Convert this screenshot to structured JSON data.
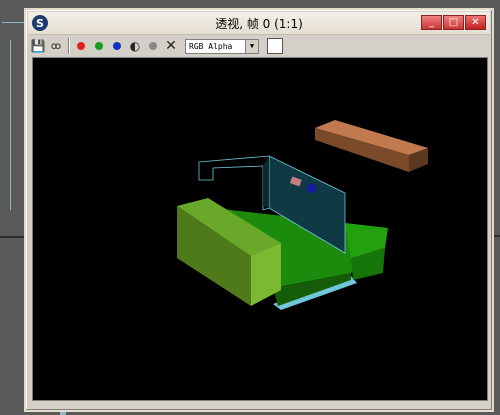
{
  "window": {
    "title": "透视, 帧 0 (1:1)",
    "icon": "3dsmax-logo-icon"
  },
  "title_buttons": [
    "minimize-icon",
    "maximize-icon",
    "close-icon"
  ],
  "toolbar": {
    "buttons": [
      "save-icon",
      "clone-icon",
      "red-channel-icon",
      "green-channel-icon",
      "blue-channel-icon",
      "mono-icon",
      "alpha-icon",
      "clear-icon"
    ],
    "channel_colors": {
      "red": "#e02020",
      "green": "#1a9a20",
      "blue": "#1030c0"
    },
    "channel_select": "RGB Alpha",
    "background_swatch": "#ffffff"
  },
  "render": {
    "background": "#000000",
    "colors": {
      "floor": "#1c8a0c",
      "arm": "#6aa82a",
      "wall": "#0f3a44",
      "beam": "#c07a4e",
      "edge_glow": "#6fc8da"
    }
  }
}
